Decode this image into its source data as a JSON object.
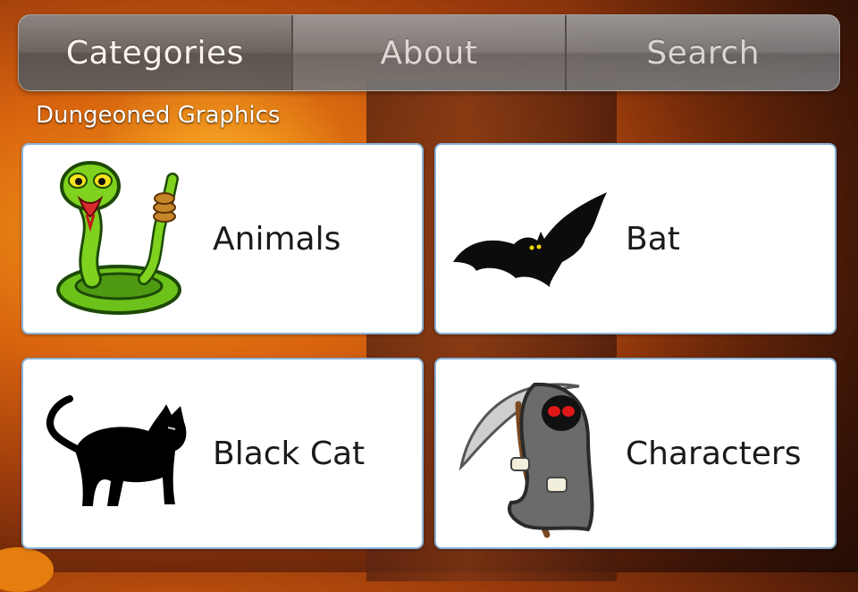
{
  "tabs": [
    {
      "label": "Categories",
      "active": true
    },
    {
      "label": "About",
      "active": false
    },
    {
      "label": "Search",
      "active": false
    }
  ],
  "section_title": "Dungeoned Graphics",
  "categories": [
    {
      "label": "Animals",
      "icon": "snake-icon"
    },
    {
      "label": "Bat",
      "icon": "bat-icon"
    },
    {
      "label": "Black Cat",
      "icon": "black-cat-icon"
    },
    {
      "label": "Characters",
      "icon": "grim-reaper-icon"
    }
  ],
  "colors": {
    "card_border": "#8bb3d8",
    "tab_active": "#5e5e5e",
    "tab_inactive": "#7e7e7e"
  }
}
